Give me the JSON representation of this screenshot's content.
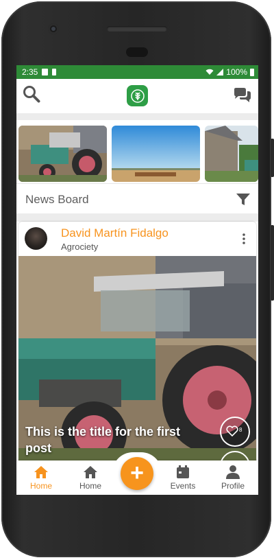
{
  "status_bar": {
    "time": "2:35",
    "battery": "100%"
  },
  "app": {
    "logo_icon": "leaf-icon"
  },
  "section": {
    "title": "News Board"
  },
  "post": {
    "author": "David Martín Fidalgo",
    "organization": "Agrociety",
    "title": "This is the title for the first post",
    "likes": "8"
  },
  "bottom_nav": [
    {
      "label": "Home",
      "icon": "home-icon",
      "active": true
    },
    {
      "label": "Home",
      "icon": "home-icon",
      "active": false
    },
    {
      "label": "Events",
      "icon": "calendar-icon",
      "active": false
    },
    {
      "label": "Profile",
      "icon": "person-icon",
      "active": false
    }
  ],
  "colors": {
    "status_bar": "#2e8b37",
    "accent": "#f7931e",
    "logo": "#2e9e46"
  }
}
